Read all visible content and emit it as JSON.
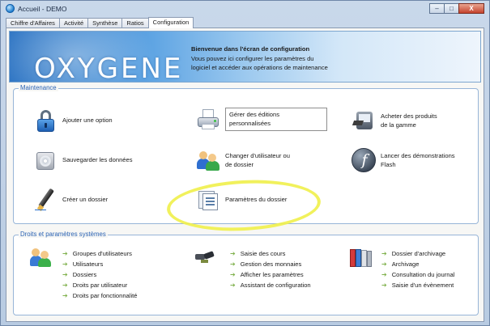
{
  "window": {
    "title": "Accueil - DEMO",
    "buttons": {
      "minimize": "–",
      "maximize": "□",
      "close": "X"
    }
  },
  "tabs": [
    {
      "label": "Chiffre d'Affaires",
      "active": false
    },
    {
      "label": "Activité",
      "active": false
    },
    {
      "label": "Synthèse",
      "active": false
    },
    {
      "label": "Ratios",
      "active": false
    },
    {
      "label": "Configuration",
      "active": true
    }
  ],
  "banner": {
    "logo": "OXYGENE",
    "welcome_title": "Bienvenue dans l'écran de configuration",
    "welcome_text": "Vous pouvez ici configurer les paramètres du logiciel et accéder aux opérations de maintenance"
  },
  "maintenance": {
    "title": "Maintenance",
    "items": [
      {
        "icon": "lock-icon",
        "label": "Ajouter une option"
      },
      {
        "icon": "printer-icon",
        "label_line1": "Gérer des éditions",
        "label_line2": "personnalisées"
      },
      {
        "icon": "shopping-cart-icon",
        "label_line1": "Acheter des produits",
        "label_line2": "de la gamme"
      },
      {
        "icon": "disk-icon",
        "label": "Sauvegarder les données"
      },
      {
        "icon": "users-icon",
        "label_line1": "Changer d'utilisateur ou",
        "label_line2": "de dossier"
      },
      {
        "icon": "flash-icon",
        "label_line1": "Lancer des démonstrations",
        "label_line2": "Flash"
      },
      {
        "icon": "pen-icon",
        "label": "Créer un dossier"
      },
      {
        "icon": "folder-settings-icon",
        "label": "Paramètres du dossier"
      }
    ]
  },
  "droits": {
    "title": "Droits et paramètres systèmes",
    "col1": [
      "Groupes d'utilisateurs",
      "Utilisateurs",
      "Dossiers",
      "Droits par utilisateur",
      "Droits par fonctionnalité"
    ],
    "col2": [
      "Saisie des cours",
      "Gestion des monnaies",
      "Afficher les paramètres",
      "Assistant de configuration"
    ],
    "col3": [
      "Dossier d'archivage",
      "Archivage",
      "Consultation du journal",
      "Saisie d'un évènement"
    ]
  },
  "colors": {
    "accent_blue": "#2a62b3",
    "highlight_yellow": "#f0f04a",
    "link_arrow": "#7fb04b"
  }
}
